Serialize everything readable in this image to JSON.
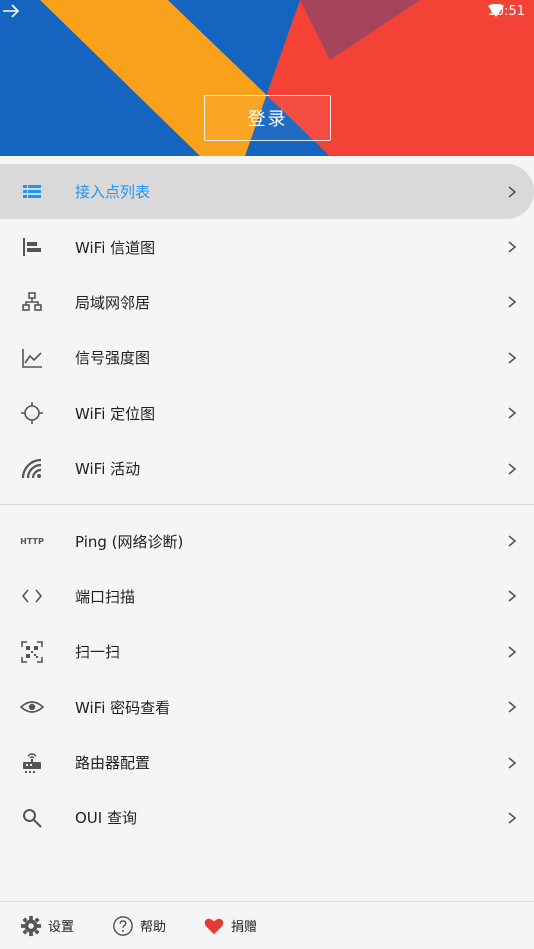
{
  "status_bar": {
    "time": "10:51"
  },
  "header": {
    "login_label": "登录",
    "colors": {
      "blue": "#1565c0",
      "yellow": "#f9a11b",
      "red": "#f44336"
    }
  },
  "menu": {
    "items": [
      {
        "label": "接入点列表",
        "icon": "list-icon",
        "active": true
      },
      {
        "label": "WiFi 信道图",
        "icon": "channel-chart-icon"
      },
      {
        "label": "局域网邻居",
        "icon": "lan-icon"
      },
      {
        "label": "信号强度图",
        "icon": "line-chart-icon"
      },
      {
        "label": "WiFi 定位图",
        "icon": "crosshair-icon"
      },
      {
        "label": "WiFi 活动",
        "icon": "signal-wave-icon"
      },
      {
        "label": "Ping (网络诊断)",
        "icon": "http-icon",
        "icon_text": "HTTP"
      },
      {
        "label": "端口扫描",
        "icon": "code-brackets-icon"
      },
      {
        "label": "扫一扫",
        "icon": "qr-scan-icon"
      },
      {
        "label": "WiFi 密码查看",
        "icon": "eye-icon"
      },
      {
        "label": "路由器配置",
        "icon": "router-icon"
      },
      {
        "label": "OUI 查询",
        "icon": "search-icon"
      }
    ]
  },
  "bottom_bar": {
    "settings": "设置",
    "help": "帮助",
    "donate": "捐赠"
  },
  "accent": "#2196f3"
}
